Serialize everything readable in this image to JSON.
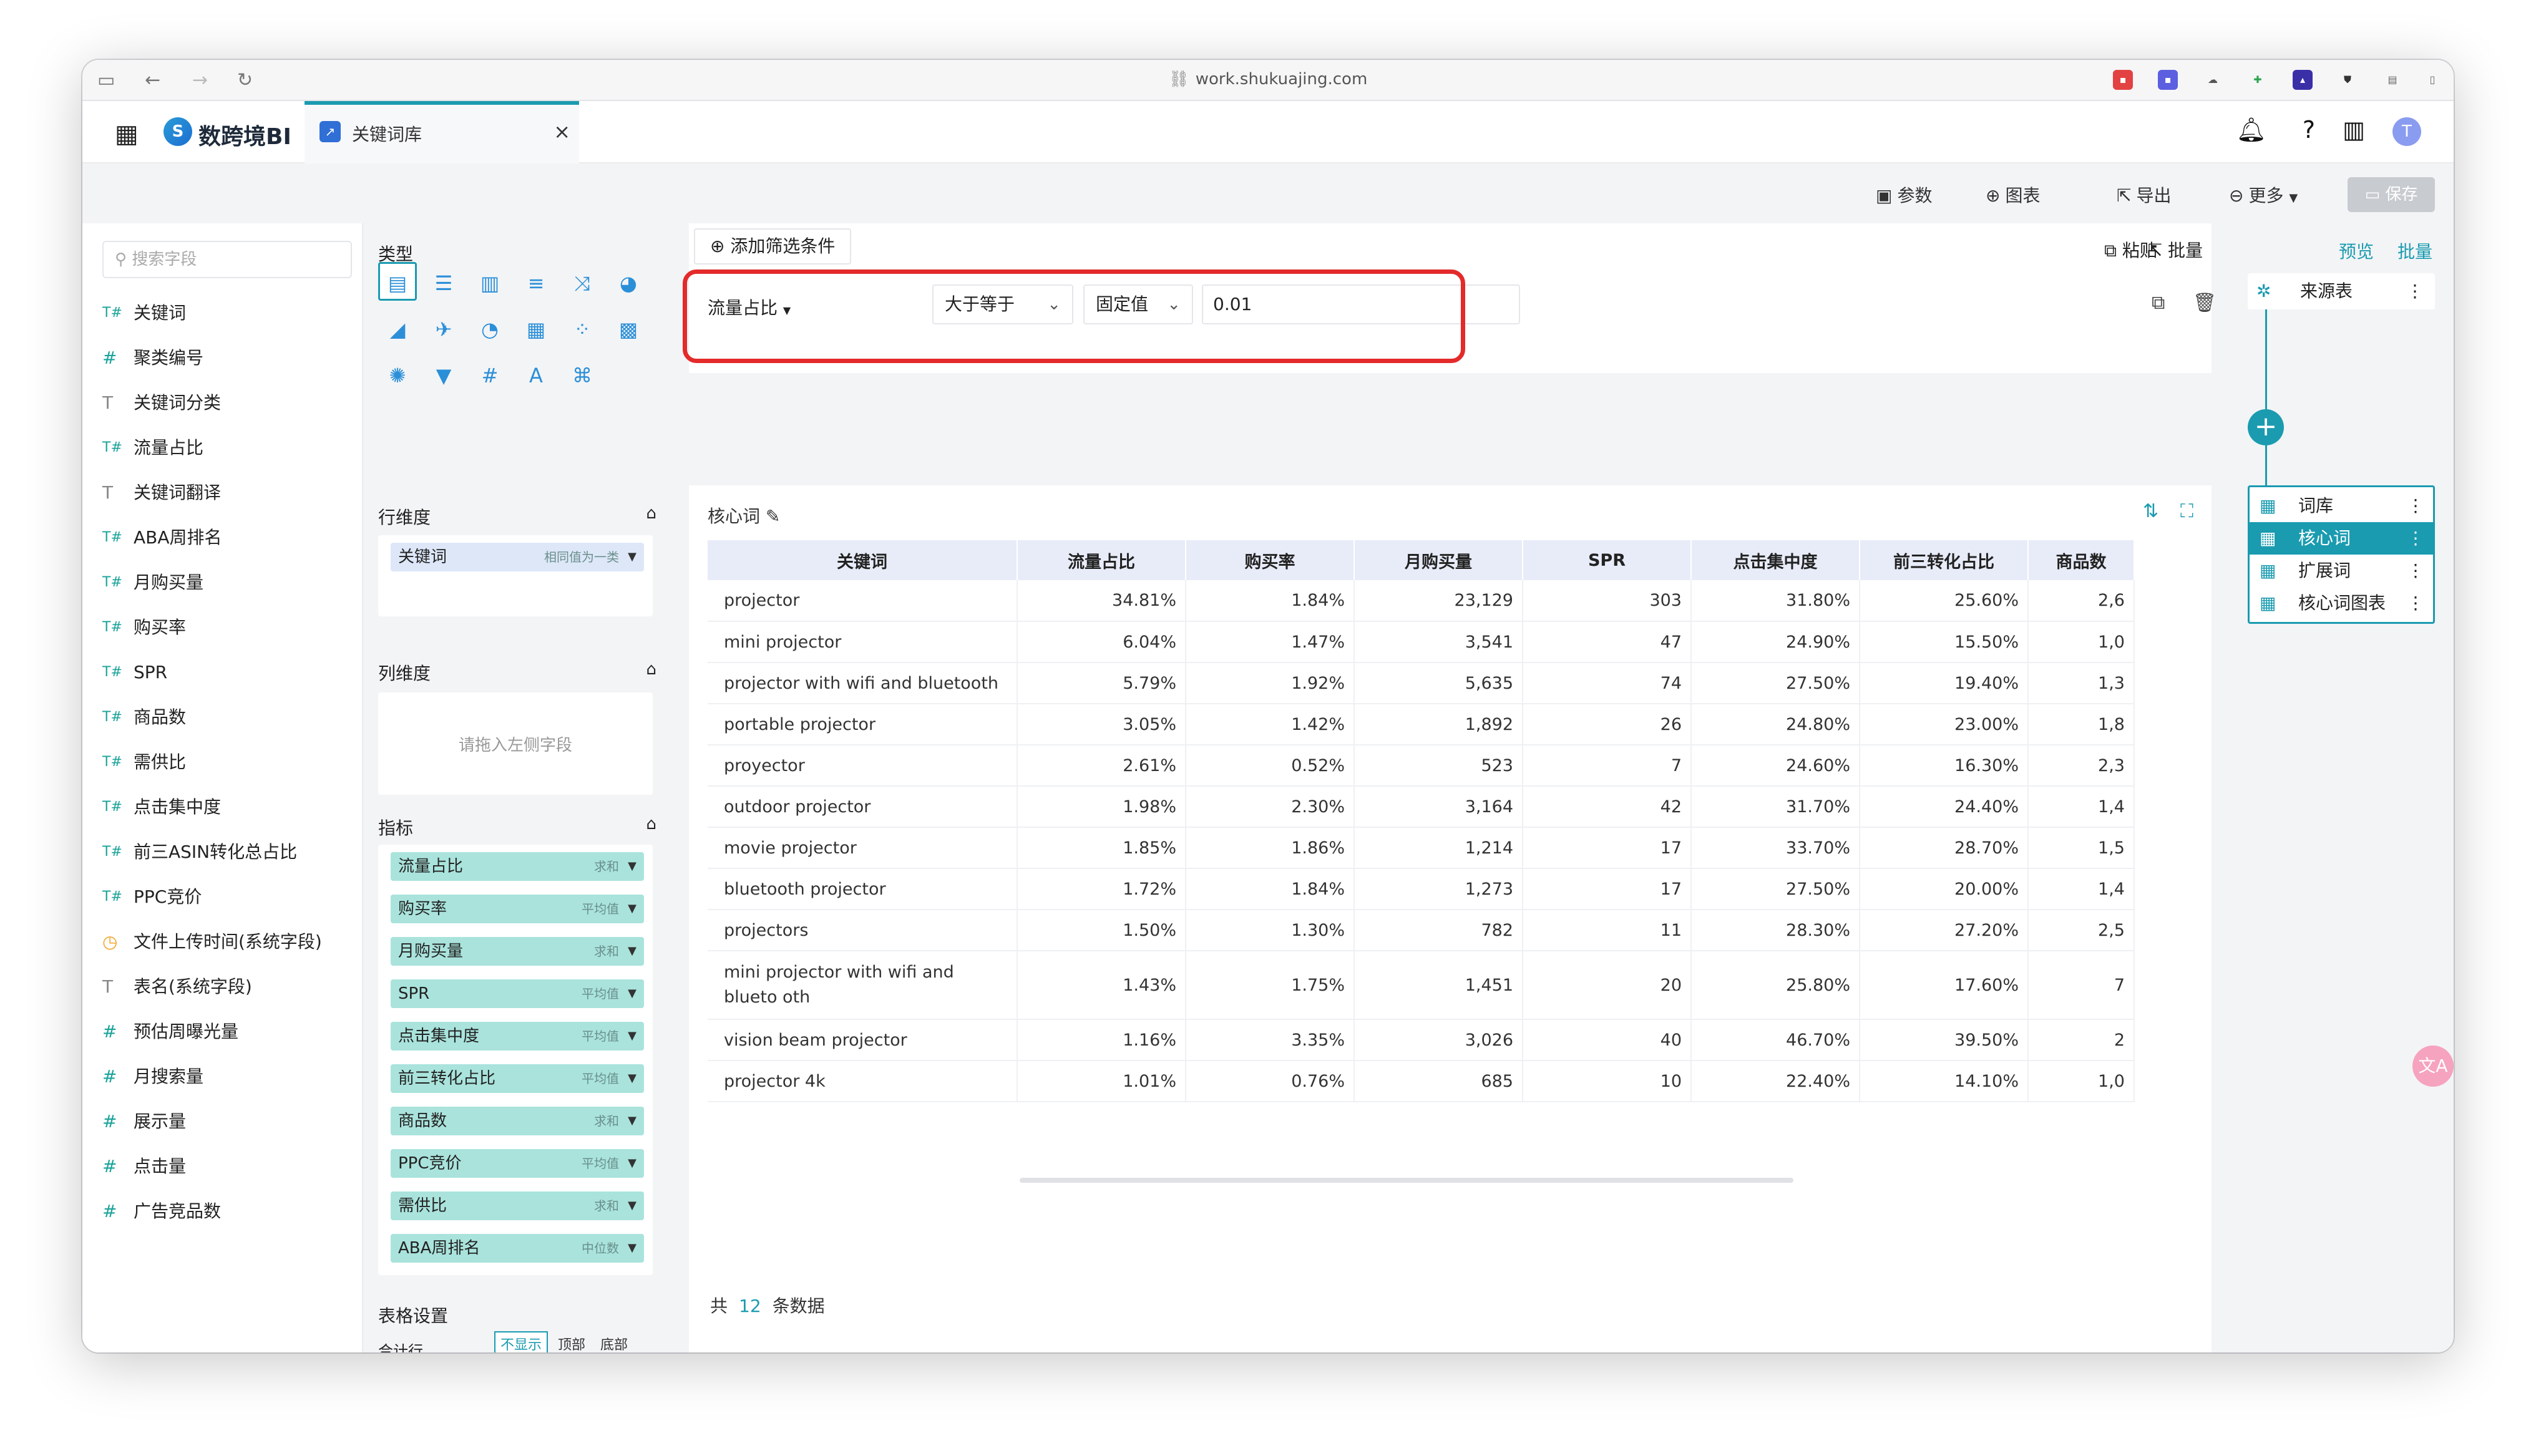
{
  "browser": {
    "url": "work.shukuajing.com"
  },
  "app": {
    "logo_text": "数跨境BI",
    "tab_label": "关键词库",
    "avatar_letter": "T"
  },
  "toolbar": {
    "params": "参数",
    "chart": "图表",
    "export": "导出",
    "more": "更多",
    "save": "保存"
  },
  "fields": {
    "search_placeholder": "搜索字段",
    "items": [
      {
        "icon": "text-number",
        "label": "关键词"
      },
      {
        "icon": "number",
        "label": "聚类编号"
      },
      {
        "icon": "text",
        "label": "关键词分类"
      },
      {
        "icon": "text-number",
        "label": "流量占比"
      },
      {
        "icon": "text",
        "label": "关键词翻译"
      },
      {
        "icon": "text-number",
        "label": "ABA周排名"
      },
      {
        "icon": "text-number",
        "label": "月购买量"
      },
      {
        "icon": "text-number",
        "label": "购买率"
      },
      {
        "icon": "text-number",
        "label": "SPR"
      },
      {
        "icon": "text-number",
        "label": "商品数"
      },
      {
        "icon": "text-number",
        "label": "需供比"
      },
      {
        "icon": "text-number",
        "label": "点击集中度"
      },
      {
        "icon": "text-number",
        "label": "前三ASIN转化总占比"
      },
      {
        "icon": "text-number",
        "label": "PPC竞价"
      },
      {
        "icon": "clock",
        "label": "文件上传时间(系统字段)"
      },
      {
        "icon": "text",
        "label": "表名(系统字段)"
      },
      {
        "icon": "number",
        "label": "预估周曝光量"
      },
      {
        "icon": "number",
        "label": "月搜索量"
      },
      {
        "icon": "number",
        "label": "展示量"
      },
      {
        "icon": "number",
        "label": "点击量"
      },
      {
        "icon": "number",
        "label": "广告竞品数"
      }
    ]
  },
  "config": {
    "type_title": "类型",
    "row_dim_title": "行维度",
    "row_chip": {
      "label": "关键词",
      "agg": "相同值为一类"
    },
    "col_dim_title": "列维度",
    "col_placeholder": "请拖入左侧字段",
    "metrics_title": "指标",
    "metrics": [
      {
        "label": "流量占比",
        "agg": "求和"
      },
      {
        "label": "购买率",
        "agg": "平均值"
      },
      {
        "label": "月购买量",
        "agg": "求和"
      },
      {
        "label": "SPR",
        "agg": "平均值"
      },
      {
        "label": "点击集中度",
        "agg": "平均值"
      },
      {
        "label": "前三转化占比",
        "agg": "平均值"
      },
      {
        "label": "商品数",
        "agg": "求和"
      },
      {
        "label": "PPC竞价",
        "agg": "平均值"
      },
      {
        "label": "需供比",
        "agg": "求和"
      },
      {
        "label": "ABA周排名",
        "agg": "中位数"
      }
    ],
    "table_settings_title": "表格设置",
    "total_row_label": "合计行",
    "total_row_options": [
      "不显示",
      "顶部",
      "底部"
    ]
  },
  "filter": {
    "add_label": "添加筛选条件",
    "paste": "粘贴",
    "batch": "批量",
    "field": "流量占比",
    "operator": "大于等于",
    "value_type": "固定值",
    "value": "0.01"
  },
  "table": {
    "title": "核心词",
    "columns": [
      "关键词",
      "流量占比",
      "购买率",
      "月购买量",
      "SPR",
      "点击集中度",
      "前三转化占比",
      "商品数"
    ],
    "rows": [
      [
        "projector",
        "34.81%",
        "1.84%",
        "23,129",
        "303",
        "31.80%",
        "25.60%",
        "2,6"
      ],
      [
        "mini projector",
        "6.04%",
        "1.47%",
        "3,541",
        "47",
        "24.90%",
        "15.50%",
        "1,0"
      ],
      [
        "projector with wifi and bluetooth",
        "5.79%",
        "1.92%",
        "5,635",
        "74",
        "27.50%",
        "19.40%",
        "1,3"
      ],
      [
        "portable projector",
        "3.05%",
        "1.42%",
        "1,892",
        "26",
        "24.80%",
        "23.00%",
        "1,8"
      ],
      [
        "proyector",
        "2.61%",
        "0.52%",
        "523",
        "7",
        "24.60%",
        "16.30%",
        "2,3"
      ],
      [
        "outdoor projector",
        "1.98%",
        "2.30%",
        "3,164",
        "42",
        "31.70%",
        "24.40%",
        "1,4"
      ],
      [
        "movie projector",
        "1.85%",
        "1.86%",
        "1,214",
        "17",
        "33.70%",
        "28.70%",
        "1,5"
      ],
      [
        "bluetooth projector",
        "1.72%",
        "1.84%",
        "1,273",
        "17",
        "27.50%",
        "20.00%",
        "1,4"
      ],
      [
        "projectors",
        "1.50%",
        "1.30%",
        "782",
        "11",
        "28.30%",
        "27.20%",
        "2,5"
      ],
      [
        "mini projector with wifi and blueto oth",
        "1.43%",
        "1.75%",
        "1,451",
        "20",
        "25.80%",
        "17.60%",
        "7"
      ],
      [
        "vision beam projector",
        "1.16%",
        "3.35%",
        "3,026",
        "40",
        "46.70%",
        "39.50%",
        "2"
      ],
      [
        "projector 4k",
        "1.01%",
        "0.76%",
        "685",
        "10",
        "22.40%",
        "14.10%",
        "1,0"
      ]
    ],
    "footer_prefix": "共",
    "footer_count": "12",
    "footer_suffix": "条数据"
  },
  "flow": {
    "preview": "预览",
    "batch": "批量",
    "source": "来源表",
    "nodes": [
      {
        "label": "词库",
        "active": false
      },
      {
        "label": "核心词",
        "active": true
      },
      {
        "label": "扩展词",
        "active": false
      },
      {
        "label": "核心词图表",
        "active": false
      }
    ]
  },
  "colors": {
    "accent": "#1a9bb0",
    "highlight": "#e42a2a",
    "chip": "#a9e3dc"
  }
}
